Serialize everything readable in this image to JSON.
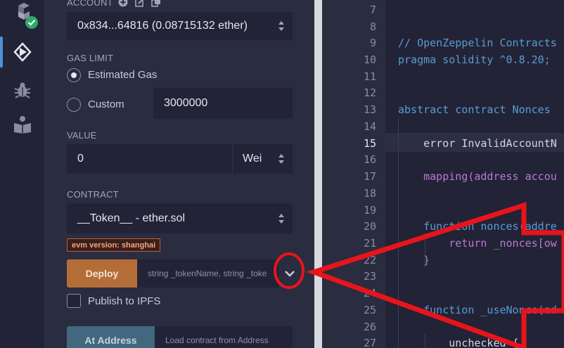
{
  "deploy_panel": {
    "account": {
      "label": "ACCOUNT",
      "value": "0x834...64816 (0.08715132 ether)"
    },
    "gas_limit": {
      "label": "GAS LIMIT",
      "estimated_label": "Estimated Gas",
      "custom_label": "Custom",
      "custom_value": "3000000",
      "selected": "estimated"
    },
    "value": {
      "label": "VALUE",
      "amount": "0",
      "unit": "Wei"
    },
    "contract": {
      "label": "CONTRACT",
      "selected": "__Token__ - ether.sol",
      "evm_badge": "evm version: shanghai"
    },
    "deploy": {
      "button_label": "Deploy",
      "params_placeholder": "string _tokenName, string _toke"
    },
    "publish_ipfs_label": "Publish to IPFS",
    "at_address": {
      "button_label": "At Address",
      "placeholder": "Load contract from Address"
    }
  },
  "icons": [
    "solidity-compiler-icon",
    "check-badge-icon",
    "deploy-run-icon",
    "debugger-bug-icon",
    "learneth-book-icon",
    "info-icon",
    "copy-icon",
    "edit-icon",
    "chevron-down-icon"
  ],
  "editor": {
    "active_line": 15,
    "lines": [
      {
        "n": "7",
        "text": ""
      },
      {
        "n": "8",
        "text": ""
      },
      {
        "n": "9",
        "text": "// OpenZeppelin Contracts"
      },
      {
        "n": "10",
        "text": "pragma solidity ^0.8.20;"
      },
      {
        "n": "11",
        "text": ""
      },
      {
        "n": "12",
        "text": ""
      },
      {
        "n": "13",
        "text": "abstract contract Nonces"
      },
      {
        "n": "14",
        "text": ""
      },
      {
        "n": "15",
        "text": "    error InvalidAccountN"
      },
      {
        "n": "16",
        "text": ""
      },
      {
        "n": "17",
        "text": "    mapping(address accou"
      },
      {
        "n": "18",
        "text": ""
      },
      {
        "n": "19",
        "text": ""
      },
      {
        "n": "20",
        "text": "    function nonces(addre"
      },
      {
        "n": "21",
        "text": "        return _nonces[ow"
      },
      {
        "n": "22",
        "text": "    }"
      },
      {
        "n": "23",
        "text": ""
      },
      {
        "n": "24",
        "text": ""
      },
      {
        "n": "25",
        "text": "    function _useNonce(ad"
      },
      {
        "n": "26",
        "text": ""
      },
      {
        "n": "27",
        "text": "        unchecked {"
      }
    ]
  },
  "colors": {
    "panel_bg": "#2a2c3f",
    "input_bg": "#222336",
    "deploy_button": "#b56d37",
    "at_address_button": "#41687f",
    "annotation_red": "#e8141b",
    "keyword_blue": "#5a9bd5",
    "keyword_purple": "#b77ad4"
  }
}
